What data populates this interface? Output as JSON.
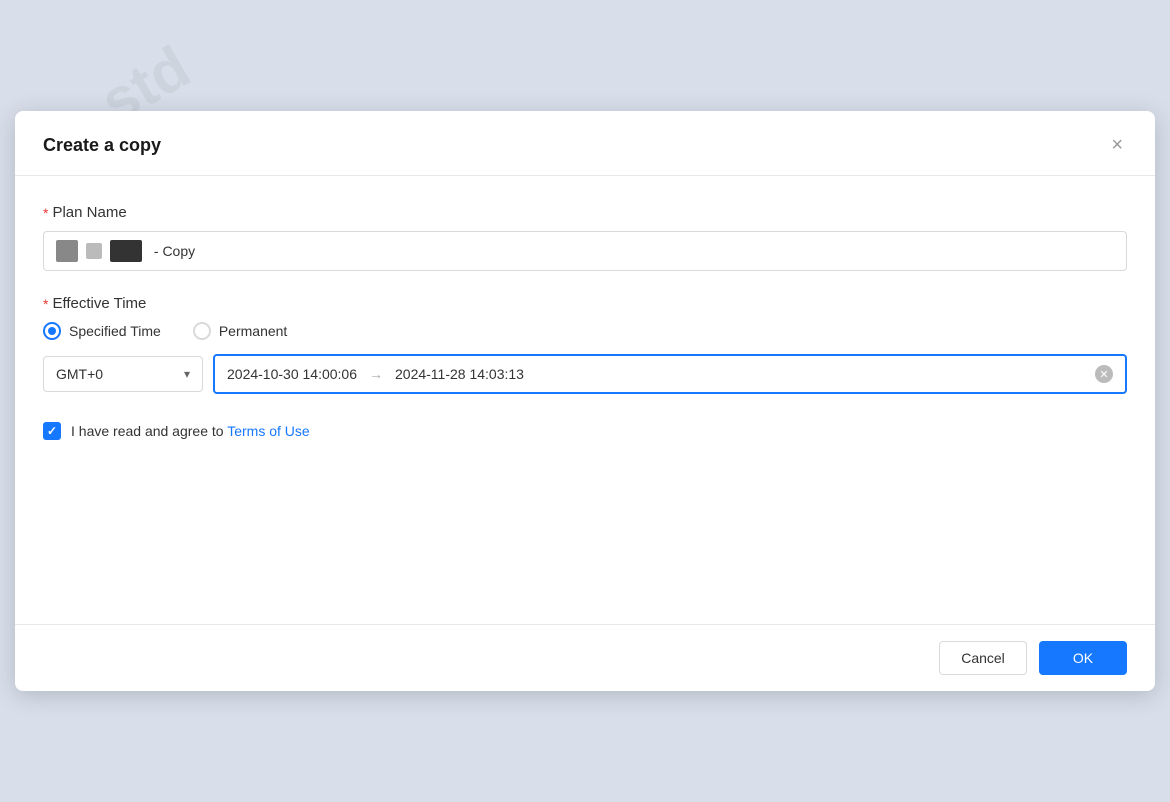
{
  "dialog": {
    "title": "Create a copy",
    "close_label": "×"
  },
  "plan_name": {
    "label": "Plan Name",
    "required": "*",
    "value": " - Copy"
  },
  "effective_time": {
    "label": "Effective Time",
    "required": "*",
    "specified_time_label": "Specified Time",
    "permanent_label": "Permanent",
    "timezone": "GMT+0",
    "start_date": "2024-10-30 14:00:06",
    "end_date": "2024-11-28 14:03:13"
  },
  "terms": {
    "prefix": "I have read and agree to ",
    "link_label": "Terms of Use"
  },
  "footer": {
    "cancel_label": "Cancel",
    "ok_label": "OK"
  }
}
